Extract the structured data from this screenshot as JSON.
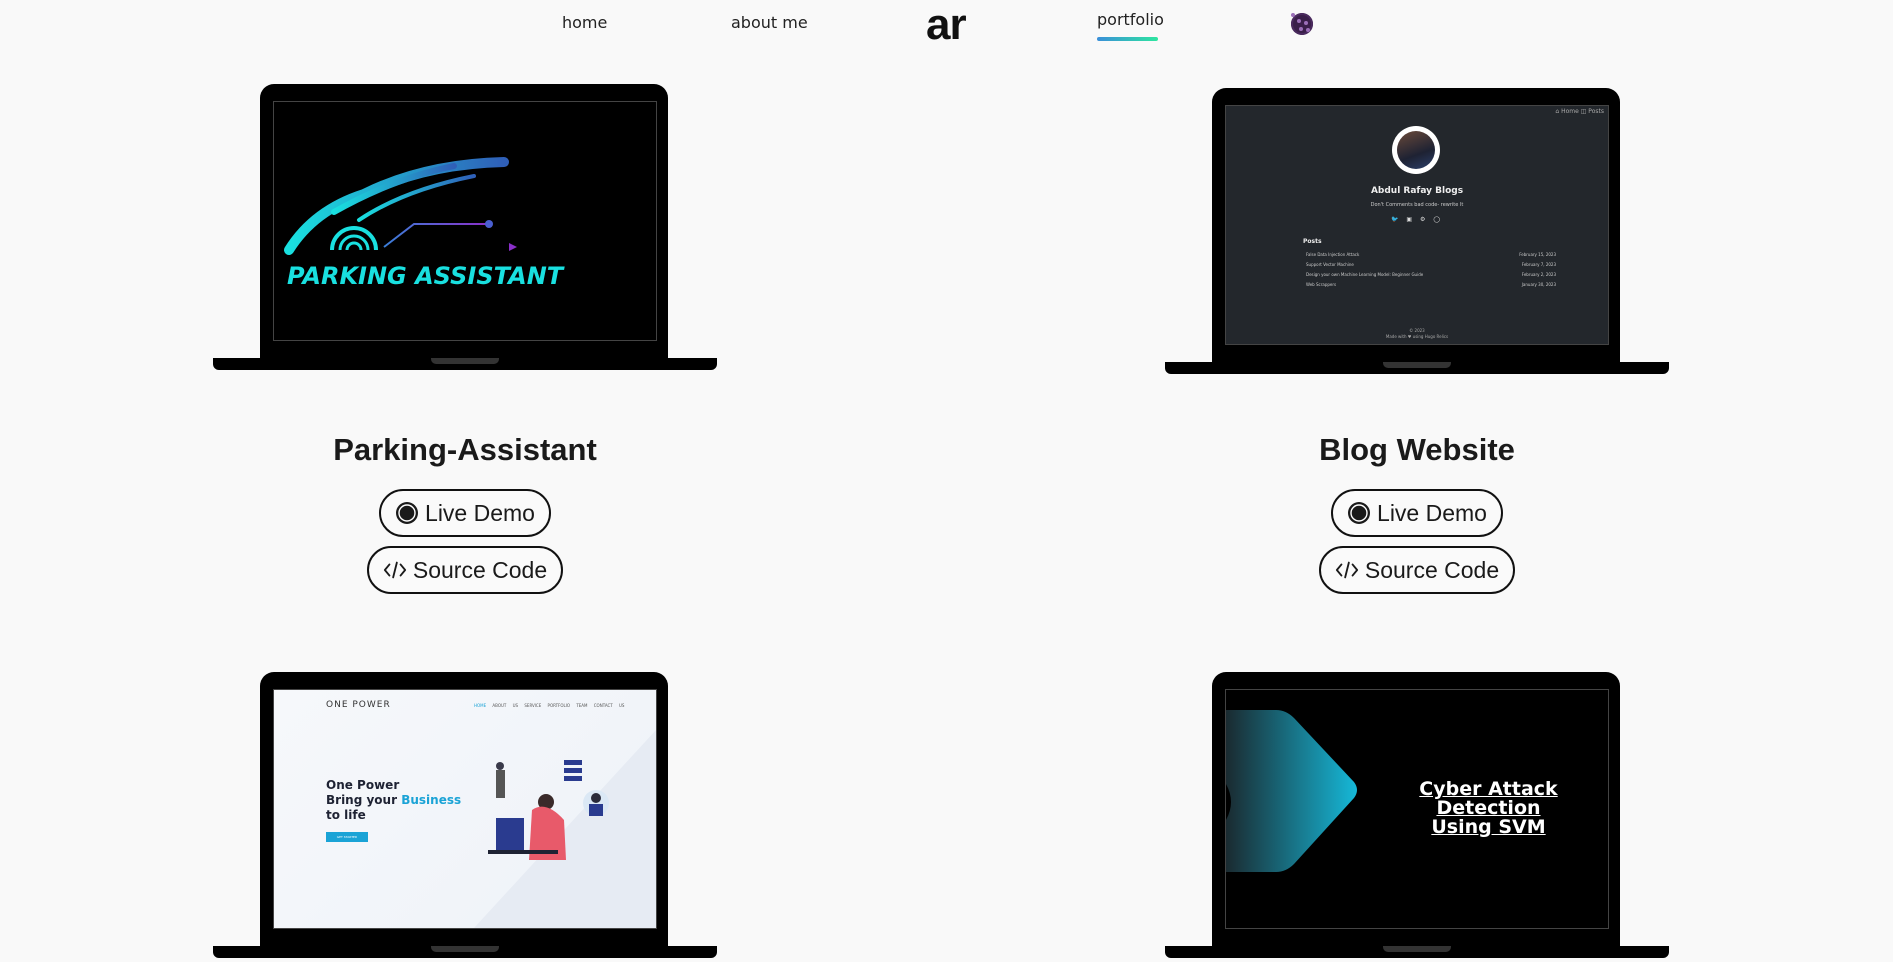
{
  "nav": {
    "home": "home",
    "about": "about me",
    "logo": "ar",
    "portfolio": "portfolio",
    "theme_icon": "theme-toggle-icon"
  },
  "projects": [
    {
      "title": "Parking-Assistant",
      "live_label": "Live Demo",
      "source_label": "Source Code",
      "screen_text": "PARKING ASSISTANT"
    },
    {
      "title": "Blog Website",
      "live_label": "Live Demo",
      "source_label": "Source Code",
      "screen": {
        "nav": "⌂ Home   ◫ Posts",
        "name": "Abdul Rafay Blogs",
        "tagline": "Don't Comments bad code- rewrite It",
        "posts_heading": "Posts",
        "posts": [
          {
            "title": "False Data Injection Attack",
            "date": "February 15, 2023"
          },
          {
            "title": "Support Vector Machine",
            "date": "February 7, 2023"
          },
          {
            "title": "Design your own Machine Learning Model: Beginner Guide",
            "date": "February 2, 2023"
          },
          {
            "title": "Web Scrappers",
            "date": "January 30, 2023"
          }
        ],
        "footer1": "© 2023",
        "footer2": "Made with ♥ using Hugo Relics"
      }
    },
    {
      "screen": {
        "brand": "ONE POWER",
        "menu": [
          "HOME",
          "ABOUT US",
          "SERVICE",
          "PORTFOLIO",
          "TEAM",
          "CONTACT US"
        ],
        "heading1": "One Power",
        "heading2a": "Bring your ",
        "heading2b": "Business",
        "heading3": "to life",
        "cta": "GET STARTED"
      }
    },
    {
      "screen_text1": "Cyber Attack Detection",
      "screen_text2": "Using SVM"
    }
  ],
  "colors": {
    "accent_gradient_start": "#3a8fd9",
    "accent_gradient_end": "#2ee6a0",
    "cyan": "#19e0e0"
  }
}
